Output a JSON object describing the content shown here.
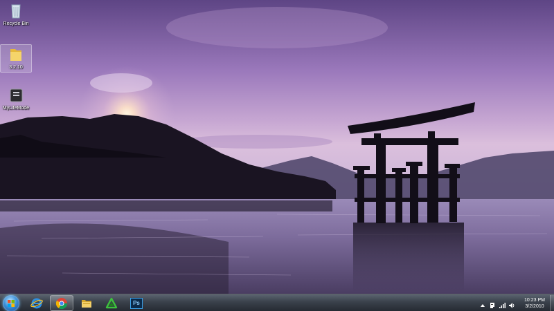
{
  "desktop": {
    "icons": [
      {
        "label": "Recycle Bin"
      },
      {
        "label": "3.2.10"
      },
      {
        "label": "MyLifeMode"
      }
    ]
  },
  "taskbar": {
    "pinned": [
      {
        "app": "internet-explorer"
      },
      {
        "app": "chrome"
      },
      {
        "app": "windows-explorer"
      },
      {
        "app": "green-app"
      },
      {
        "app": "photoshop",
        "text": "Ps"
      }
    ],
    "clock": {
      "time": "10:23 PM",
      "date": "3/2/2010"
    }
  },
  "colors": {
    "sky_top": "#6f4f92",
    "sky_mid": "#b592c8",
    "sky_horizon": "#e8c9dc",
    "water": "#8a7aa8",
    "silhouette": "#14101c",
    "taskbar": "#333a44"
  }
}
